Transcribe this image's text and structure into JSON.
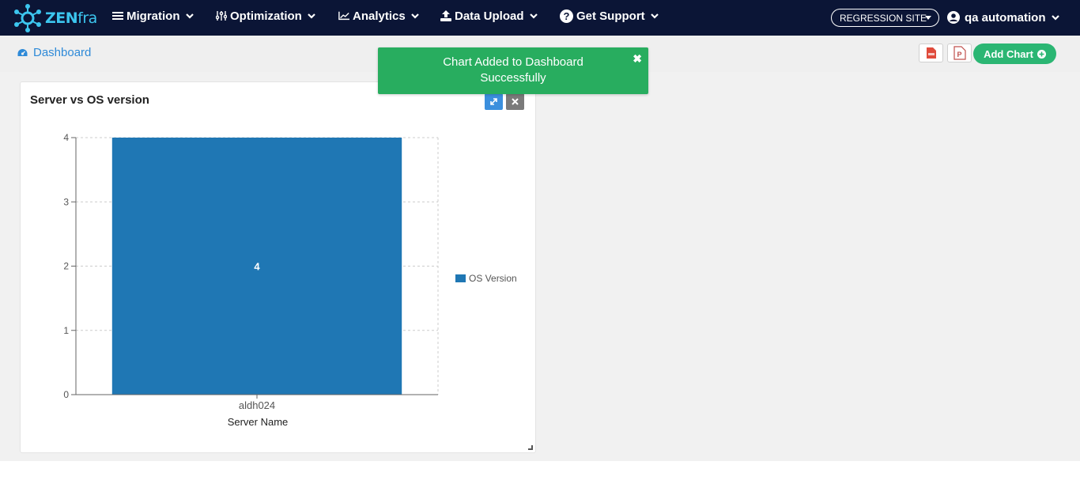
{
  "app": {
    "logo_text_main": "ZEN",
    "logo_text_tail": "fra",
    "logo_icon": "zenfra-gear-logo"
  },
  "nav": {
    "items": [
      {
        "label": "Migration",
        "icon": "list-icon"
      },
      {
        "label": "Optimization",
        "icon": "sliders-icon"
      },
      {
        "label": "Analytics",
        "icon": "line-chart-icon"
      },
      {
        "label": "Data Upload",
        "icon": "upload-icon"
      },
      {
        "label": "Get Support",
        "icon": "question-circle-icon"
      }
    ],
    "site_selector": "REGRESSION SITE",
    "user_name": "qa automation"
  },
  "subheader": {
    "breadcrumb": "Dashboard",
    "add_chart_label": "Add Chart",
    "pdf_icon": "pdf-file-icon",
    "ppt_icon": "ppt-file-icon"
  },
  "toast": {
    "message_line1": "Chart Added to Dashboard",
    "message_line2": "Successfully",
    "close_symbol": "✖"
  },
  "card": {
    "title": "Server vs OS version",
    "expand_icon": "expand-icon",
    "close_icon": "close-icon"
  },
  "colors": {
    "nav_bg": "#0b1536",
    "accent_blue": "#2e8ad8",
    "success_green": "#28ad5f",
    "add_chart_green": "#2bb673",
    "bar_color": "#1f77b4"
  },
  "chart_data": {
    "type": "bar",
    "categories": [
      "aldh024"
    ],
    "series": [
      {
        "name": "OS Version",
        "values": [
          4
        ]
      }
    ],
    "xlabel": "Server Name",
    "ylabel": "",
    "ylim": [
      0,
      4
    ],
    "yticks": [
      0,
      1,
      2,
      3,
      4
    ],
    "data_labels": [
      "4"
    ],
    "grid": true,
    "legend_position": "right"
  }
}
